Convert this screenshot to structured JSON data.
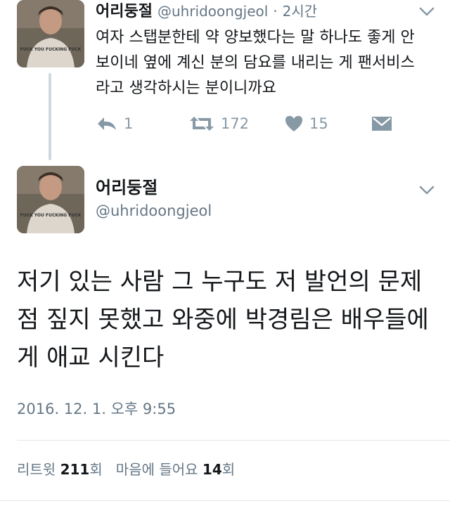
{
  "tweet1": {
    "name": "어리둥절",
    "handle": "@uhridoongjeol",
    "separator": "·",
    "time": "2시간",
    "text": "여자 스탭분한테 약 양보했다는 말 하나도 좋게 안 보이네 옆에 계신 분의 담요를 내리는 게 팬서비스라고 생각하시는 분이니까요",
    "avatar_caption": "FUCK YOU FUCKING FUCK",
    "actions": {
      "reply_icon": "reply-icon",
      "reply_count": "1",
      "retweet_icon": "retweet-icon",
      "retweet_count": "172",
      "like_icon": "heart-icon",
      "like_count": "15",
      "dm_icon": "envelope-icon"
    }
  },
  "tweet2": {
    "name": "어리둥절",
    "handle": "@uhridoongjeol",
    "text": "저기 있는 사람 그 누구도 저 발언의 문제점 짚지 못했고 와중에 박경림은 배우들에게 애교 시킨다",
    "date": "2016. 12. 1. 오후 9:55",
    "avatar_caption": "FUCK YOU FUCKING FUCK",
    "stats": {
      "retweets_label": "리트윗",
      "retweets_count": "211",
      "retweets_unit": "회",
      "likes_label": "마음에 들어요",
      "likes_count": "14",
      "likes_unit": "회"
    }
  },
  "colors": {
    "text_primary": "#14171a",
    "text_secondary": "#657786",
    "icon_gray": "#8899a6",
    "divider": "#e1e8ed",
    "thread_line": "#cfd9de"
  }
}
